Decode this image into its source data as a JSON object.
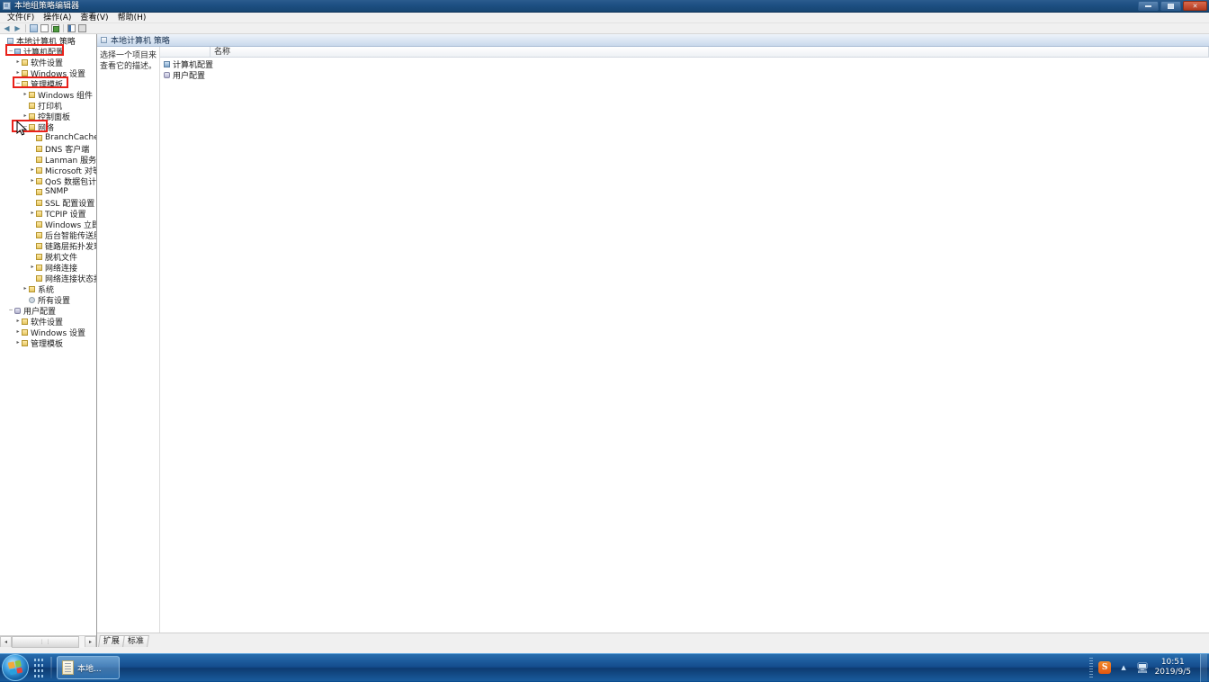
{
  "window": {
    "title": "本地组策略编辑器",
    "icon": "policy-editor-icon",
    "buttons": {
      "minimize": "最小化",
      "maximize": "最大化",
      "close": "关闭"
    }
  },
  "menubar": {
    "items": [
      {
        "label": "文件(F)",
        "name": "menu-file"
      },
      {
        "label": "操作(A)",
        "name": "menu-action"
      },
      {
        "label": "查看(V)",
        "name": "menu-view"
      },
      {
        "label": "帮助(H)",
        "name": "menu-help"
      }
    ]
  },
  "toolbar": {
    "buttons": [
      {
        "name": "back-button",
        "glyph": "←"
      },
      {
        "name": "forward-button",
        "glyph": "→"
      },
      {
        "name": "up-folder-button",
        "glyph": ""
      },
      {
        "name": "show-hide-tree-button",
        "glyph": ""
      },
      {
        "name": "refresh-button",
        "glyph": ""
      },
      {
        "name": "properties-button",
        "glyph": ""
      },
      {
        "name": "help-button",
        "glyph": ""
      }
    ]
  },
  "tree": {
    "root": {
      "label": "本地计算机 策略",
      "icon": "policy-root-icon",
      "depth": 0
    },
    "nodes": [
      {
        "label": "计算机配置",
        "icon": "computer-icon",
        "depth": 1,
        "expander": "−",
        "highlight": true
      },
      {
        "label": "软件设置",
        "icon": "folder-icon",
        "depth": 2,
        "expander": "▸"
      },
      {
        "label": "Windows 设置",
        "icon": "folder-icon",
        "depth": 2,
        "expander": "▸"
      },
      {
        "label": "管理模板",
        "icon": "folder-icon",
        "depth": 2,
        "expander": "−",
        "highlight": true
      },
      {
        "label": "Windows 组件",
        "icon": "folder-icon",
        "depth": 3,
        "expander": "▸"
      },
      {
        "label": "打印机",
        "icon": "folder-icon",
        "depth": 3,
        "expander": ""
      },
      {
        "label": "控制面板",
        "icon": "folder-icon",
        "depth": 3,
        "expander": "▸"
      },
      {
        "label": "网络",
        "icon": "folder-icon",
        "depth": 3,
        "expander": "−",
        "highlight": true
      },
      {
        "label": "BranchCache",
        "icon": "folder-icon",
        "depth": 4,
        "expander": ""
      },
      {
        "label": "DNS 客户端",
        "icon": "folder-icon",
        "depth": 4,
        "expander": ""
      },
      {
        "label": "Lanman 服务器",
        "icon": "folder-icon",
        "depth": 4,
        "expander": ""
      },
      {
        "label": "Microsoft 对等网络",
        "icon": "folder-icon",
        "depth": 4,
        "expander": "▸"
      },
      {
        "label": "QoS 数据包计划程序",
        "icon": "folder-icon",
        "depth": 4,
        "expander": "▸"
      },
      {
        "label": "SNMP",
        "icon": "folder-icon",
        "depth": 4,
        "expander": ""
      },
      {
        "label": "SSL 配置设置",
        "icon": "folder-icon",
        "depth": 4,
        "expander": ""
      },
      {
        "label": "TCPIP 设置",
        "icon": "folder-icon",
        "depth": 4,
        "expander": "▸"
      },
      {
        "label": "Windows 立即连接",
        "icon": "folder-icon",
        "depth": 4,
        "expander": ""
      },
      {
        "label": "后台智能传送服务(BITS)",
        "icon": "folder-icon",
        "depth": 4,
        "expander": ""
      },
      {
        "label": "链路层拓扑发现",
        "icon": "folder-icon",
        "depth": 4,
        "expander": ""
      },
      {
        "label": "脱机文件",
        "icon": "folder-icon",
        "depth": 4,
        "expander": ""
      },
      {
        "label": "网络连接",
        "icon": "folder-icon",
        "depth": 4,
        "expander": "▸"
      },
      {
        "label": "网络连接状态指示器",
        "icon": "folder-icon",
        "depth": 4,
        "expander": ""
      },
      {
        "label": "系统",
        "icon": "folder-icon",
        "depth": 3,
        "expander": "▸"
      },
      {
        "label": "所有设置",
        "icon": "settings-icon",
        "depth": 3,
        "expander": ""
      },
      {
        "label": "用户配置",
        "icon": "user-icon",
        "depth": 1,
        "expander": "−"
      },
      {
        "label": "软件设置",
        "icon": "folder-icon",
        "depth": 2,
        "expander": "▸"
      },
      {
        "label": "Windows 设置",
        "icon": "folder-icon",
        "depth": 2,
        "expander": "▸"
      },
      {
        "label": "管理模板",
        "icon": "folder-icon",
        "depth": 2,
        "expander": "▸"
      }
    ],
    "hscroll": {
      "left_glyph": "◂",
      "right_glyph": "▸",
      "thumb_glyph": "⋮⋮"
    }
  },
  "right_pane": {
    "header": {
      "title": "本地计算机 策略",
      "icon": "policy-header-icon"
    },
    "description": "选择一个项目来查看它的描述。",
    "columns": [
      {
        "label": "",
        "name": "column-desc-spacer"
      },
      {
        "label": "名称",
        "name": "column-name"
      }
    ],
    "rows": [
      {
        "label": "计算机配置",
        "icon": "computer-icon"
      },
      {
        "label": "用户配置",
        "icon": "user-icon"
      }
    ],
    "tabs": [
      {
        "label": "扩展",
        "name": "tab-extended"
      },
      {
        "label": "标准",
        "name": "tab-standard",
        "active": true
      }
    ]
  },
  "annotations": {
    "color": "#e8211a",
    "boxes": [
      {
        "name": "annotation-computer-config",
        "target": "计算机配置"
      },
      {
        "name": "annotation-admin-templates",
        "target": "管理模板"
      },
      {
        "name": "annotation-network",
        "target": "网络"
      }
    ]
  },
  "taskbar": {
    "start_button": "开始",
    "buttons": [
      {
        "label": "本地...",
        "name": "taskbar-gpedit-button",
        "icon": "document-icon"
      }
    ],
    "tray": [
      {
        "name": "snipping-tool-icon",
        "glyph": "S"
      },
      {
        "name": "show-hidden-icons-icon",
        "glyph": "▲"
      },
      {
        "name": "network-icon",
        "glyph": "🖧"
      }
    ],
    "clock": {
      "time": "10:51",
      "date": "2019/9/5"
    }
  }
}
